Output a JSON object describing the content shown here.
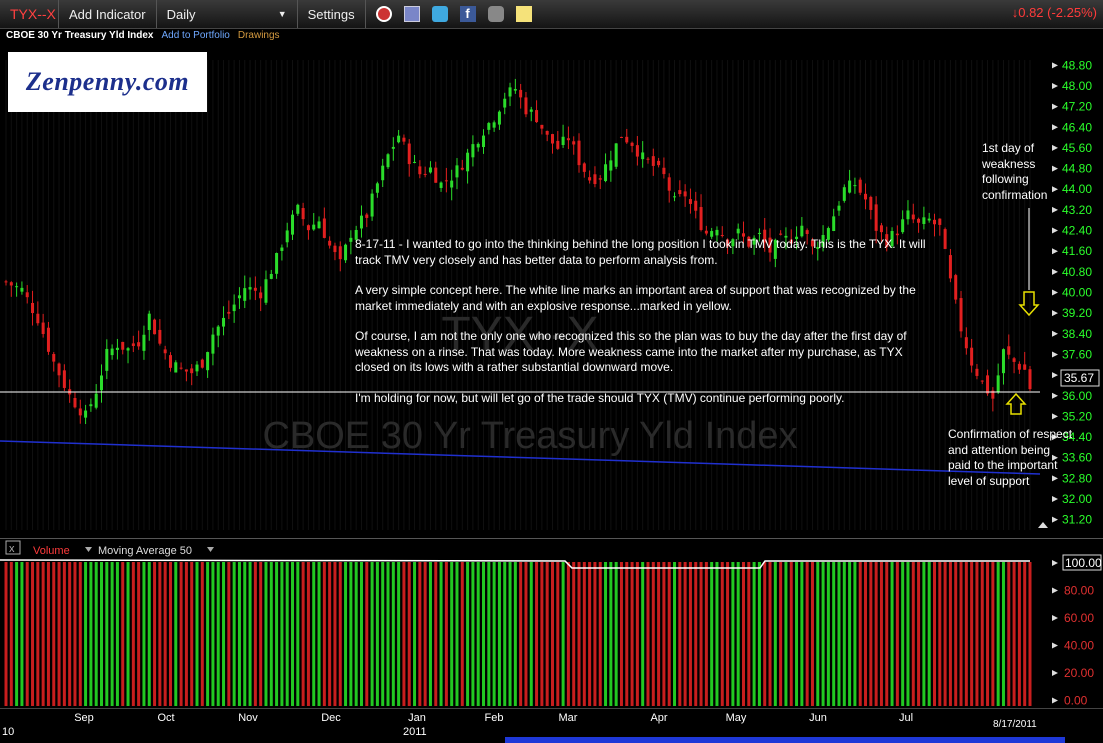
{
  "toolbar": {
    "symbol": "TYX--X",
    "add_indicator": "Add Indicator",
    "period": "Daily",
    "settings": "Settings",
    "change": "↓0.82 (-2.25%)"
  },
  "subtitle": {
    "name": "CBOE 30 Yr Treasury Yld Index",
    "add_portfolio": "Add to Portfolio",
    "drawings": "Drawings"
  },
  "logo_text": "Zenpenny.com",
  "watermark": {
    "symbol": "TYX--X",
    "name": "CBOE 30 Yr Treasury Yld Index"
  },
  "annotation": {
    "p1": "8-17-11 - I wanted to go into the thinking behind the long position I took in TMV today. This is the TYX. It will track TMV very closely and has better data to perform analysis from.",
    "p2": "A very simple concept here. The white line marks an important area of support that was recognized by the market immediately and with an explosive response...marked in yellow.",
    "p3": "Of course, I am not the only one who recognized this so the plan was to buy the day after the first day of weakness on a rinse. That was today. More weakness came into the market after my purchase, as TYX closed on its lows with a rather substantial downward move.",
    "p4": "I'm holding for now, but will let go of the trade should TYX (TMV) continue performing poorly.",
    "first_day": "1st day of weakness following confirmation",
    "confirmation": "Confirmation of respect and attention being paid to the important level of support"
  },
  "price_axis": [
    "48.80",
    "48.00",
    "47.20",
    "46.40",
    "45.60",
    "44.80",
    "44.00",
    "43.20",
    "42.40",
    "41.60",
    "40.80",
    "40.00",
    "39.20",
    "38.40",
    "37.60",
    "36.80",
    "36.00",
    "35.20",
    "34.40",
    "33.60",
    "32.80",
    "32.00",
    "31.20"
  ],
  "last_price": "35.67",
  "volume_panel": {
    "label": "Volume",
    "ma_label": "Moving Average 50",
    "axis": [
      "100.00",
      "80.00",
      "60.00",
      "40.00",
      "20.00",
      "0.00"
    ]
  },
  "x_axis": {
    "months": [
      "Sep",
      "Oct",
      "Nov",
      "Dec",
      "Jan",
      "Feb",
      "Mar",
      "Apr",
      "May",
      "Jun",
      "Jul"
    ],
    "year_labels": [
      "10",
      "2011"
    ],
    "date": "8/17/2011"
  },
  "chart_data": {
    "type": "candlestick",
    "support_level": 35.1,
    "ylim": [
      30.8,
      49.2
    ],
    "close_path": [
      [
        0,
        40.4
      ],
      [
        3,
        40.1
      ],
      [
        6,
        39.0
      ],
      [
        9,
        37.3
      ],
      [
        12,
        36.0
      ],
      [
        15,
        35.2
      ],
      [
        17,
        36.2
      ],
      [
        19,
        37.6
      ],
      [
        21,
        38.0
      ],
      [
        23,
        37.8
      ],
      [
        25,
        38.1
      ],
      [
        27,
        39.1
      ],
      [
        29,
        38.0
      ],
      [
        31,
        37.3
      ],
      [
        33,
        37.0
      ],
      [
        35,
        36.9
      ],
      [
        37,
        37.3
      ],
      [
        39,
        38.4
      ],
      [
        42,
        39.2
      ],
      [
        45,
        40.2
      ],
      [
        48,
        40.0
      ],
      [
        51,
        41.3
      ],
      [
        53,
        42.5
      ],
      [
        55,
        43.2
      ],
      [
        57,
        42.5
      ],
      [
        59,
        42.8
      ],
      [
        61,
        41.8
      ],
      [
        63,
        41.1
      ],
      [
        65,
        42.3
      ],
      [
        68,
        43.0
      ],
      [
        70,
        44.2
      ],
      [
        72,
        45.3
      ],
      [
        74,
        46.1
      ],
      [
        76,
        45.2
      ],
      [
        78,
        44.6
      ],
      [
        80,
        44.8
      ],
      [
        82,
        44.2
      ],
      [
        84,
        44.5
      ],
      [
        86,
        45.0
      ],
      [
        88,
        45.7
      ],
      [
        90,
        46.3
      ],
      [
        92,
        46.8
      ],
      [
        94,
        47.6
      ],
      [
        96,
        47.9
      ],
      [
        98,
        47.1
      ],
      [
        100,
        46.8
      ],
      [
        102,
        46.0
      ],
      [
        104,
        45.6
      ],
      [
        106,
        46.0
      ],
      [
        108,
        45.1
      ],
      [
        110,
        44.4
      ],
      [
        112,
        44.5
      ],
      [
        114,
        45.3
      ],
      [
        116,
        46.1
      ],
      [
        118,
        45.8
      ],
      [
        120,
        45.2
      ],
      [
        122,
        44.9
      ],
      [
        124,
        44.5
      ],
      [
        126,
        43.5
      ],
      [
        128,
        43.8
      ],
      [
        130,
        43.0
      ],
      [
        132,
        42.3
      ],
      [
        134,
        42.6
      ],
      [
        136,
        42.0
      ],
      [
        138,
        42.3
      ],
      [
        140,
        41.9
      ],
      [
        142,
        42.2
      ],
      [
        144,
        41.6
      ],
      [
        146,
        42.0
      ],
      [
        148,
        42.1
      ],
      [
        150,
        42.6
      ],
      [
        152,
        41.7
      ],
      [
        154,
        42.2
      ],
      [
        156,
        43.0
      ],
      [
        158,
        44.0
      ],
      [
        160,
        44.2
      ],
      [
        162,
        43.6
      ],
      [
        164,
        42.5
      ],
      [
        166,
        42.0
      ],
      [
        168,
        42.4
      ],
      [
        170,
        43.0
      ],
      [
        172,
        42.6
      ],
      [
        174,
        42.8
      ],
      [
        176,
        42.5
      ],
      [
        178,
        40.4
      ],
      [
        180,
        38.6
      ],
      [
        182,
        37.3
      ],
      [
        184,
        36.5
      ],
      [
        186,
        35.9
      ],
      [
        188,
        37.7
      ],
      [
        190,
        37.3
      ],
      [
        192,
        37.0
      ],
      [
        193,
        36.3
      ]
    ]
  }
}
